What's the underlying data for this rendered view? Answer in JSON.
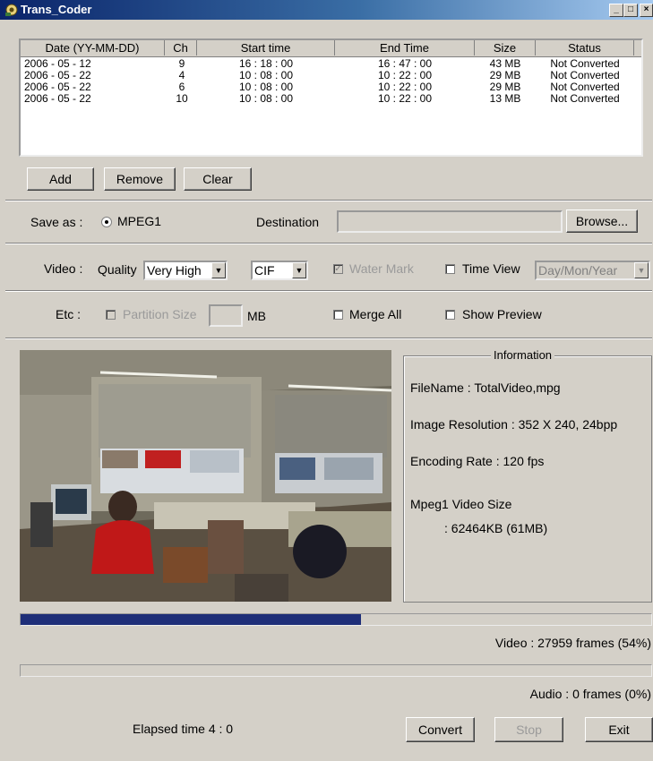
{
  "window": {
    "title": "Trans_Coder"
  },
  "file_list": {
    "columns": [
      "Date (YY-MM-DD)",
      "Ch",
      "Start time",
      "End Time",
      "Size",
      "Status"
    ],
    "rows": [
      [
        "2006 - 05 - 12",
        "9",
        "16 : 18 : 00",
        "16 : 47 : 00",
        "43 MB",
        "Not Converted"
      ],
      [
        "2006 - 05 - 22",
        "4",
        "10 : 08 : 00",
        "10 : 22 : 00",
        "29 MB",
        "Not Converted"
      ],
      [
        "2006 - 05 - 22",
        "6",
        "10 : 08 : 00",
        "10 : 22 : 00",
        "29 MB",
        "Not Converted"
      ],
      [
        "2006 - 05 - 22",
        "10",
        "10 : 08 : 00",
        "10 : 22 : 00",
        "13 MB",
        "Not Converted"
      ]
    ]
  },
  "list_buttons": {
    "add": "Add",
    "remove": "Remove",
    "clear": "Clear"
  },
  "save": {
    "label": "Save as :",
    "format": "MPEG1",
    "destination_label": "Destination",
    "destination_value": "",
    "browse": "Browse..."
  },
  "video": {
    "label": "Video :",
    "quality_label": "Quality",
    "quality_value": "Very High",
    "size_value": "CIF",
    "watermark_label": "Water Mark",
    "timeview_label": "Time View",
    "timeview_value": "Day/Mon/Year"
  },
  "etc": {
    "label": "Etc :",
    "partition_label": "Partition Size",
    "partition_unit": "MB",
    "merge_label": "Merge All",
    "preview_label": "Show Preview"
  },
  "information": {
    "title": "Information",
    "filename": "FileName : TotalVideo,mpg",
    "resolution": "Image Resolution : 352 X 240, 24bpp",
    "rate": "Encoding Rate : 120 fps",
    "size_label": "Mpeg1 Video Size",
    "size_value": ": 62464KB (61MB)"
  },
  "progress": {
    "video_fraction": 0.54,
    "audio_fraction": 0.0,
    "video_text": "Video : 27959 frames (54%)",
    "audio_text": "Audio : 0 frames (0%)"
  },
  "footer": {
    "elapsed": "Elapsed time  4 : 0",
    "convert": "Convert",
    "stop": "Stop",
    "exit": "Exit"
  },
  "colors": {
    "progress_fill": "#1e2e78",
    "title_start": "#0a246a"
  }
}
